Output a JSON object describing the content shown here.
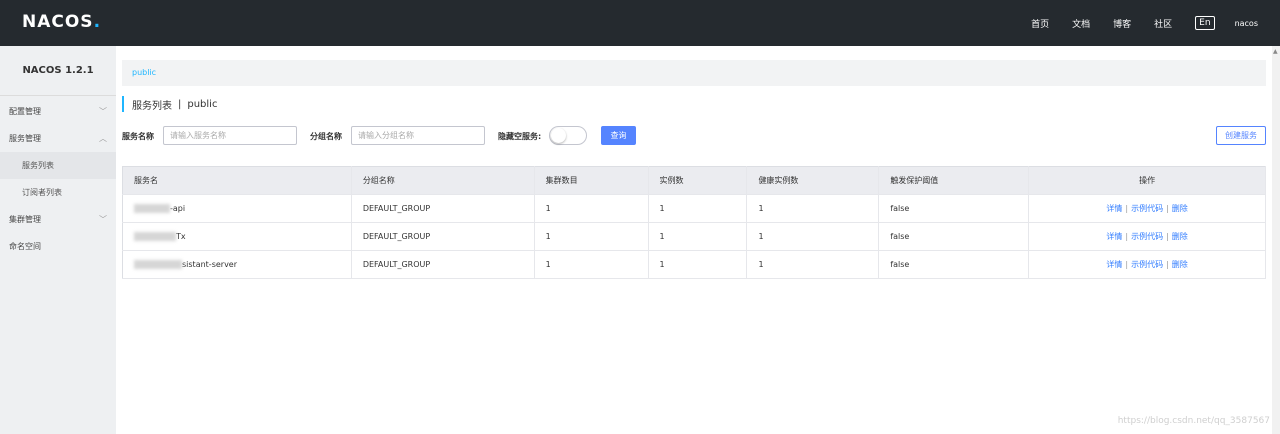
{
  "header": {
    "logo": "NACOS",
    "logo_dot": ".",
    "nav": [
      "首页",
      "文档",
      "博客",
      "社区"
    ],
    "lang": "En",
    "user": "nacos"
  },
  "sidebar": {
    "version": "NACOS 1.2.1",
    "items": [
      {
        "label": "配置管理",
        "chevron": "﹀"
      },
      {
        "label": "服务管理",
        "chevron": "︿"
      },
      {
        "label": "服务列表"
      },
      {
        "label": "订阅者列表"
      },
      {
        "label": "集群管理",
        "chevron": "﹀"
      },
      {
        "label": "命名空间"
      }
    ]
  },
  "breadcrumb": "public",
  "page": {
    "title": "服务列表",
    "separator": "|",
    "namespace": "public"
  },
  "filters": {
    "service_label": "服务名称",
    "service_placeholder": "请输入服务名称",
    "group_label": "分组名称",
    "group_placeholder": "请输入分组名称",
    "hide_empty_label": "隐藏空服务:",
    "query_button": "查询",
    "create_button": "创建服务"
  },
  "table": {
    "headers": [
      "服务名",
      "分组名称",
      "集群数目",
      "实例数",
      "健康实例数",
      "触发保护阈值",
      "操作"
    ],
    "rows": [
      {
        "name_suffix": "-api",
        "group": "DEFAULT_GROUP",
        "clusters": "1",
        "instances": "1",
        "healthy": "1",
        "threshold": "false"
      },
      {
        "name_suffix": "Tx",
        "group": "DEFAULT_GROUP",
        "clusters": "1",
        "instances": "1",
        "healthy": "1",
        "threshold": "false"
      },
      {
        "name_suffix": "sistant-server",
        "group": "DEFAULT_GROUP",
        "clusters": "1",
        "instances": "1",
        "healthy": "1",
        "threshold": "false"
      }
    ],
    "actions": {
      "detail": "详情",
      "sample": "示例代码",
      "delete": "删除",
      "sep": "|"
    }
  },
  "watermark": "https://blog.csdn.net/qq_3587567",
  "colors": {
    "topbar": "#252a2f",
    "accent": "#1fb6ff",
    "primary": "#5584ff",
    "link": "#2f7bff"
  }
}
